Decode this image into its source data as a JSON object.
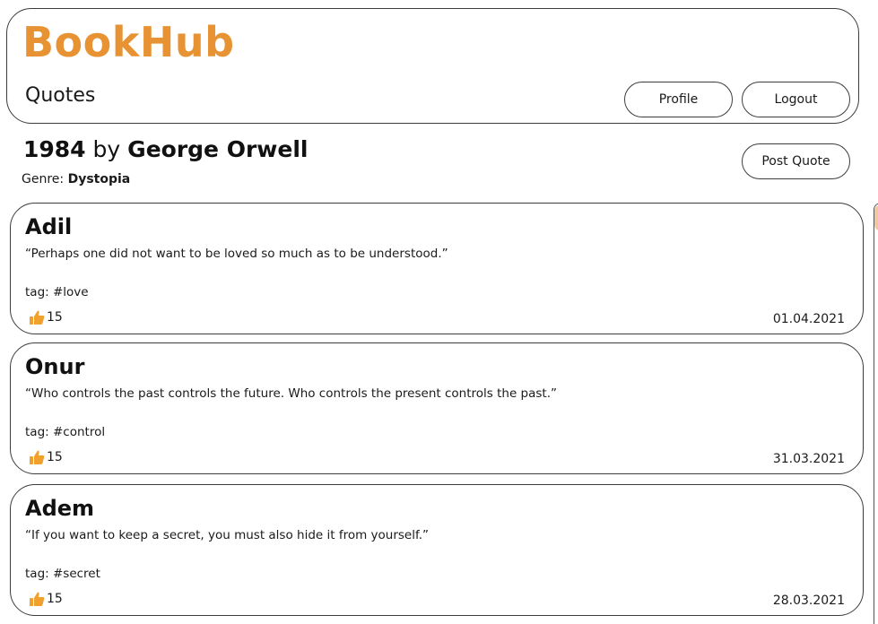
{
  "app": {
    "logo": "BookHub",
    "page_title": "Quotes"
  },
  "header": {
    "profile_label": "Profile",
    "logout_label": "Logout"
  },
  "book": {
    "title": "1984",
    "by": "by",
    "author": "George Orwell",
    "genre_label": "Genre:",
    "genre": "Dystopia",
    "post_quote_label": "Post Quote"
  },
  "colors": {
    "brand": "#e79233",
    "like_icon": "#f0a02c"
  },
  "icons": {
    "like": "thumbs-up-icon"
  },
  "quotes": [
    {
      "user": "Adil",
      "text": "“Perhaps one did not want to be loved so much as to be understood.”",
      "tag": "tag: #love",
      "likes": "15",
      "date": "01.04.2021"
    },
    {
      "user": "Onur",
      "text": "“Who controls the past controls the future. Who controls the present controls the past.”",
      "tag": "tag: #control",
      "likes": "15",
      "date": "31.03.2021"
    },
    {
      "user": "Adem",
      "text": "“If you want to keep a secret, you must also hide it from yourself.”",
      "tag": "tag: #secret",
      "likes": "15",
      "date": "28.03.2021"
    }
  ]
}
